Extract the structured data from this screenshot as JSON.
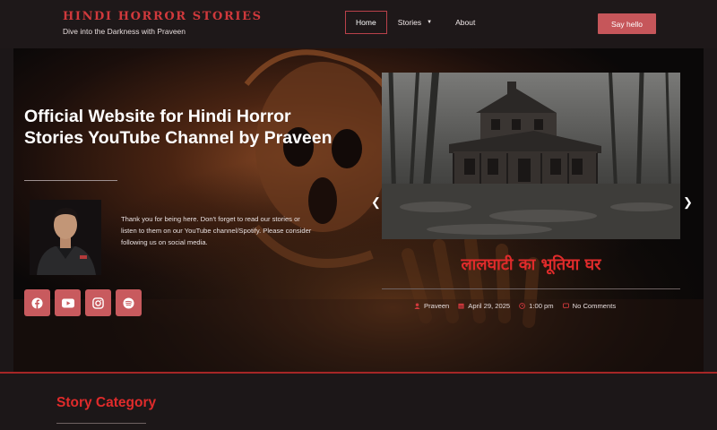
{
  "header": {
    "brand_title": "Hindi Horror Stories",
    "brand_tagline": "Dive into the Darkness with Praveen",
    "nav": [
      {
        "label": "Home",
        "active": true
      },
      {
        "label": "Stories",
        "has_dropdown": true
      },
      {
        "label": "About"
      }
    ],
    "cta_label": "Say hello"
  },
  "hero": {
    "heading": "Official Website for Hindi Horror Stories YouTube Channel by Praveen",
    "intro": "Thank you for being here. Don't forget to read our stories or listen to them on our YouTube channel/Spotify. Please consider following us on social media.",
    "socials": [
      "facebook-icon",
      "youtube-icon",
      "instagram-icon",
      "spotify-icon"
    ]
  },
  "slider": {
    "post_title": "लालघाटी का भूतिया घर",
    "meta": {
      "author": "Praveen",
      "date": "April 29, 2025",
      "time": "1:00 pm",
      "comments": "No Comments"
    }
  },
  "section": {
    "category_title": "Story Category"
  },
  "colors": {
    "accent": "#d0393c",
    "button": "#c6565a",
    "background": "#1c1718"
  }
}
